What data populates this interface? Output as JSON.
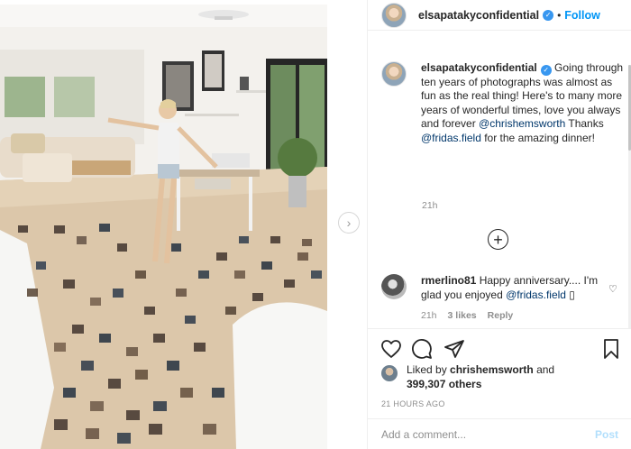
{
  "post": {
    "username": "elsapatakyconfidential",
    "verified_icon": "verified-badge-icon",
    "separator": "•",
    "follow_label": "Follow"
  },
  "caption": {
    "username": "elsapatakyconfidential",
    "text_1": " Going through ten years of photographs was almost as fun as the real thing! Here's to many more years of wonderful times, love you always and forever ",
    "mention_1": "@chrishemsworth",
    "text_2": " Thanks ",
    "mention_2": "@fridas.field",
    "text_3": " for the amazing dinner!",
    "time": "21h"
  },
  "load_more_icon": "plus-circle-icon",
  "comment": {
    "username": "rmerlino81",
    "text": " Happy anniversary.... I'm glad you enjoyed ",
    "mention": "@fridas.field",
    "emoji": "▯",
    "time": "21h",
    "likes": "3 likes",
    "reply_label": "Reply"
  },
  "likes": {
    "prefix": "Liked by ",
    "liker": "chrishemsworth",
    "middle": " and ",
    "others": "399,307 others"
  },
  "timestamp": "21 HOURS AGO",
  "add_comment": {
    "placeholder": "Add a comment...",
    "post_label": "Post"
  },
  "icons": {
    "like": "heart-icon",
    "comment": "comment-icon",
    "share": "share-icon",
    "save": "bookmark-icon",
    "next": "chevron-right-icon"
  },
  "colors": {
    "accent": "#0095f6",
    "verified": "#3897f0",
    "mention": "#00376b",
    "muted": "#8e8e8e",
    "post_disabled": "#b2dffc"
  }
}
